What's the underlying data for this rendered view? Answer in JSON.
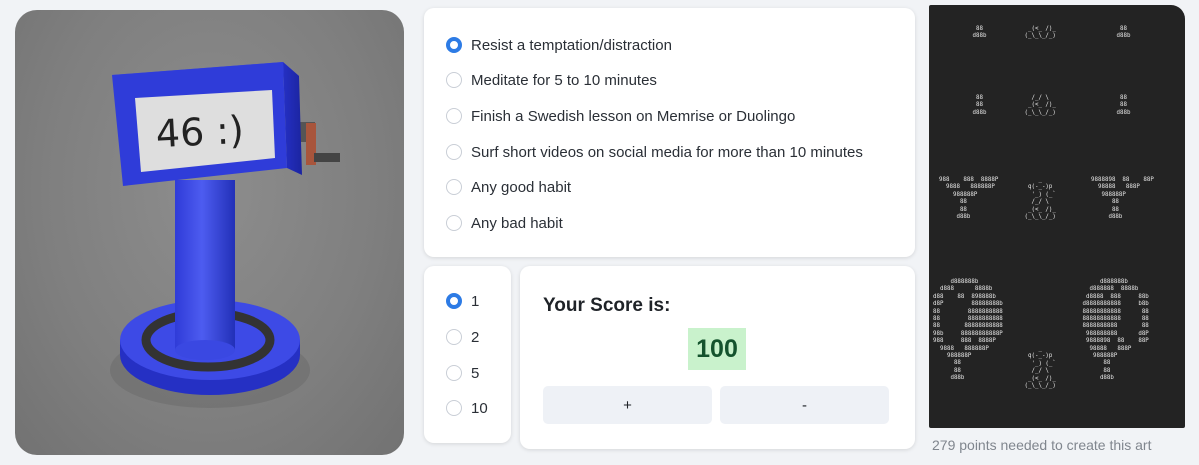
{
  "counter_image": {
    "display_text": "46 :)"
  },
  "habits": {
    "options": [
      {
        "label": "Resist a temptation/distraction",
        "checked": true
      },
      {
        "label": "Meditate for 5 to 10 minutes",
        "checked": false
      },
      {
        "label": "Finish a Swedish lesson on Memrise or Duolingo",
        "checked": false
      },
      {
        "label": "Surf short videos on social media for more than 10 minutes",
        "checked": false
      },
      {
        "label": "Any good habit",
        "checked": false
      },
      {
        "label": "Any bad habit",
        "checked": false
      }
    ]
  },
  "points": {
    "options": [
      {
        "label": "1",
        "checked": true
      },
      {
        "label": "2",
        "checked": false
      },
      {
        "label": "5",
        "checked": false
      },
      {
        "label": "10",
        "checked": false
      }
    ]
  },
  "score": {
    "title": "Your Score is:",
    "value": "100",
    "plus_label": "+",
    "minus_label": "-"
  },
  "art": {
    "caption": "279 points needed to create this art",
    "blocks": [
      "  88\n d88b",
      "  _(<_ /)_\n (_\\_\\_/_)",
      "  88\n d88b",
      "  88\n  88\n d88b",
      "   /_/ \\\n  _(<_ /)_\n (_\\_\\_/_)",
      "  88\n  88\n d88b",
      "988    888  8888P\n  9888   888888P\n    988888P\n      88\n      88\n     d88b",
      "     _\n  q(-_-)p\n   '_) (_`\n   /_/ \\\n  _(<_ /)_\n (_\\_\\_/_)",
      "9888898  88    88P\n  98888   888P\n   988888P\n      88\n      88\n     d88b",
      "     d888888b\n  d888      8888b\nd88    88  898888b\nd8P        88888888b\n88        8888888888\n88        8888888888\n88       88888888888\n98b     88888888888P\n988     888  8888P\n  9888   888888P\n    988888P\n      88\n      88\n     d88b",
      "     _\n  q(-_-)p\n   '_) (_`\n   /_/ \\\n  _(<_ /)_\n (_\\_\\_/_)",
      "      d888888b\n   d888888  8888b\n  d8888  888     88b\n d8888888888     b8b\n 88888888888      88\n 88888888888      88\n 8888888888       88\n  988888888      d8P\n  9888898  88    88P\n   98888   888P\n    988888P\n       88\n       88\n      d88b"
    ]
  }
}
